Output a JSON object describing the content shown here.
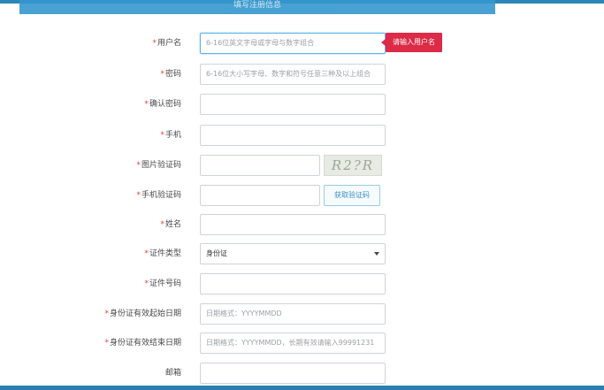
{
  "header": {
    "title": "填写注册信息"
  },
  "form": {
    "username": {
      "label": "用户名",
      "required": true,
      "placeholder": "6-16位英文字母或字母与数字组合",
      "error_tip": "请输入用户名"
    },
    "password": {
      "label": "密码",
      "required": true,
      "placeholder": "6-16位大小写字母、数字和符号任意三种及以上组合"
    },
    "confirm_password": {
      "label": "确认密码",
      "required": true,
      "placeholder": ""
    },
    "phone": {
      "label": "手机",
      "required": true,
      "placeholder": ""
    },
    "image_captcha": {
      "label": "图片验证码",
      "required": true,
      "placeholder": "",
      "captcha_text": "R2?R"
    },
    "sms_code": {
      "label": "手机验证码",
      "required": true,
      "placeholder": "",
      "button_label": "获取验证码"
    },
    "name": {
      "label": "姓名",
      "required": true,
      "placeholder": ""
    },
    "id_type": {
      "label": "证件类型",
      "required": true,
      "selected": "身份证"
    },
    "id_number": {
      "label": "证件号码",
      "required": true,
      "placeholder": ""
    },
    "id_valid_start": {
      "label": "身份证有效起始日期",
      "required": true,
      "placeholder": "日期格式：YYYYMMDD"
    },
    "id_valid_end": {
      "label": "身份证有效结束日期",
      "required": true,
      "placeholder": "日期格式：YYYYMMDD，长期有效请输入99991231"
    },
    "email": {
      "label": "邮箱",
      "required": false,
      "placeholder": ""
    }
  },
  "colors": {
    "accent": "#3597cf",
    "error": "#dc2b47",
    "required_mark": "#e0413b"
  }
}
